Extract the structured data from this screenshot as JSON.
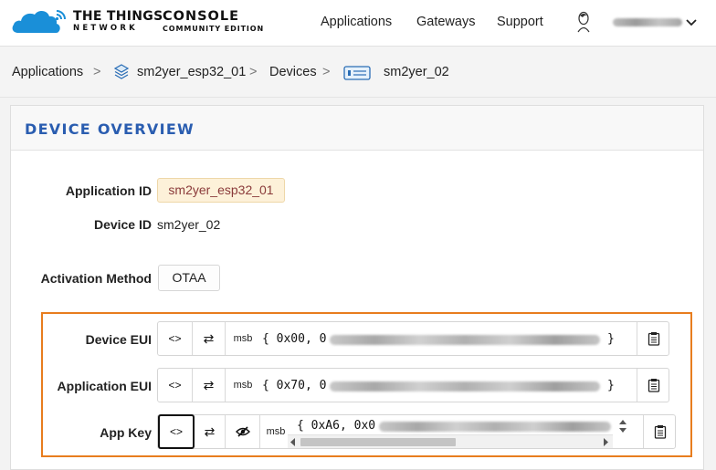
{
  "header": {
    "brand_line1": "THE THINGS",
    "brand_line2": "NETWORK",
    "console_line1": "CONSOLE",
    "console_line2": "COMMUNITY EDITION",
    "nav": [
      "Applications",
      "Gateways",
      "Support"
    ]
  },
  "breadcrumb": {
    "items": [
      "Applications",
      "sm2yer_esp32_01",
      "Devices",
      "sm2yer_02"
    ],
    "separator": ">"
  },
  "overview": {
    "title": "DEVICE OVERVIEW",
    "application_id_label": "Application ID",
    "application_id": "sm2yer_esp32_01",
    "device_id_label": "Device ID",
    "device_id": "sm2yer_02",
    "activation_label": "Activation Method",
    "activation": "OTAA"
  },
  "keys": {
    "byte_order": "msb",
    "toggle_format_glyph": "<>",
    "swap_glyph": "⇄",
    "brace_close": "}",
    "device_eui_label": "Device EUI",
    "device_eui_prefix": "{ 0x00, 0",
    "application_eui_label": "Application EUI",
    "application_eui_prefix": "{ 0x70, 0",
    "app_key_label": "App Key",
    "app_key_prefix": "{ 0xA6, 0x0"
  },
  "colors": {
    "accent_blue": "#2a5db0",
    "highlight_orange": "#e87d1e",
    "chip_bg": "#fdf1d9",
    "cloud_blue": "#1a8fd8"
  },
  "icons": [
    "cloud-logo-icon",
    "avatar-icon",
    "chevron-down-icon",
    "stack-icon",
    "device-icon",
    "code-icon",
    "swap-icon",
    "eye-slash-icon",
    "clipboard-icon"
  ]
}
